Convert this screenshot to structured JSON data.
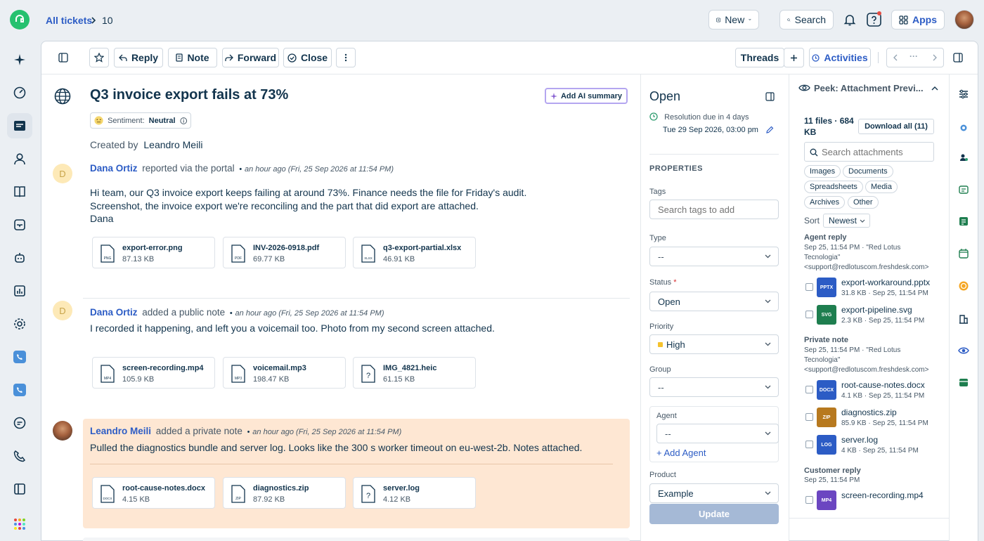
{
  "topbar": {
    "breadcrumb_root": "All tickets",
    "ticket_id": "10",
    "new_label": "New",
    "search_label": "Search",
    "apps_label": "Apps"
  },
  "toolbar": {
    "reply": "Reply",
    "note": "Note",
    "forward": "Forward",
    "close": "Close",
    "threads": "Threads",
    "activities": "Activities",
    "pager_dots": "···"
  },
  "ticket": {
    "title": "Q3 invoice export fails at 73%",
    "ai_summary": "Add AI summary",
    "sentiment_label": "Sentiment:",
    "sentiment_value": "Neutral",
    "created_by_label": "Created by",
    "created_by": "Leandro Meili"
  },
  "conversation": [
    {
      "avatar": "D",
      "author": "Dana Ortiz",
      "action": "reported via the portal",
      "bullet": "•",
      "time": "an hour ago (Fri, 25 Sep 2026 at 11:54 PM)",
      "lines": [
        "Hi team, our Q3 invoice export keeps failing at around 73%. Finance needs the file for Friday's audit.",
        "Screenshot, the invoice export we're reconciling and the part that did export are attached.",
        "Dana"
      ],
      "attachments": [
        {
          "name": "export-error.png",
          "size": "87.13 KB",
          "icon": "PNG"
        },
        {
          "name": "INV-2026-0918.pdf",
          "size": "69.77 KB",
          "icon": "PDF"
        },
        {
          "name": "q3-export-partial.xlsx",
          "size": "46.91 KB",
          "icon": "XLSX"
        }
      ]
    },
    {
      "avatar": "D",
      "author": "Dana Ortiz",
      "action": "added a public note",
      "bullet": "•",
      "time": "an hour ago (Fri, 25 Sep 2026 at 11:54 PM)",
      "lines": [
        "I recorded it happening, and left you a voicemail too. Photo from my second screen attached."
      ],
      "attachments": [
        {
          "name": "screen-recording.mp4",
          "size": "105.9 KB",
          "icon": "MP4"
        },
        {
          "name": "voicemail.mp3",
          "size": "198.47 KB",
          "icon": "MP3"
        },
        {
          "name": "IMG_4821.heic",
          "size": "61.15 KB",
          "icon": "?"
        }
      ]
    },
    {
      "author": "Leandro Meili",
      "action": "added a private note",
      "bullet": "•",
      "time": "an hour ago (Fri, 25 Sep 2026 at 11:54 PM)",
      "lines": [
        "Pulled the diagnostics bundle and server log. Looks like the 300 s worker timeout on eu-west-2b. Notes attached."
      ],
      "attachments": [
        {
          "name": "root-cause-notes.docx",
          "size": "4.15 KB",
          "icon": "DOCX"
        },
        {
          "name": "diagnostics.zip",
          "size": "87.92 KB",
          "icon": "ZIP"
        },
        {
          "name": "server.log",
          "size": "4.12 KB",
          "icon": "?"
        }
      ]
    }
  ],
  "properties": {
    "status_header": "Open",
    "resolution_label": "Resolution due in 4 days",
    "resolution_date": "Tue 29 Sep 2026, 03:00 pm",
    "section_title": "PROPERTIES",
    "tags_label": "Tags",
    "tags_placeholder": "Search tags to add",
    "type_label": "Type",
    "type_value": "--",
    "status_label": "Status",
    "required_mark": "*",
    "status_value": "Open",
    "priority_label": "Priority",
    "priority_value": "High",
    "group_label": "Group",
    "group_value": "--",
    "agent_label": "Agent",
    "agent_value": "--",
    "add_agent": "+ Add Agent",
    "product_label": "Product",
    "product_value": "Example",
    "update_button": "Update",
    "colors": {
      "priority_high": "#f5c22d",
      "accent": "#2c5cc5"
    }
  },
  "peek": {
    "title": "Peek: Attachment Previ...",
    "summary": "11 files · 684 KB",
    "download_all": "Download all (11)",
    "search_placeholder": "Search attachments",
    "filters": [
      "Images",
      "Documents",
      "Spreadsheets",
      "Media",
      "Archives",
      "Other"
    ],
    "sort_label": "Sort",
    "sort_value": "Newest",
    "groups": [
      {
        "title": "Agent reply",
        "meta": [
          "Sep 25, 11:54 PM · \"Red Lotus",
          "Tecnologia\"",
          "<support@redlotuscom.freshdesk.com>"
        ],
        "files": [
          {
            "badge": "PPTX",
            "name": "export-workaround.pptx",
            "meta": "31.8 KB · Sep 25, 11:54 PM",
            "color": "#2c5cc5"
          },
          {
            "badge": "SVG",
            "name": "export-pipeline.svg",
            "meta": "2.3 KB · Sep 25, 11:54 PM",
            "color": "#1e7e4f"
          }
        ]
      },
      {
        "title": "Private note",
        "meta": [
          "Sep 25, 11:54 PM · \"Red Lotus",
          "Tecnologia\"",
          "<support@redlotuscom.freshdesk.com>"
        ],
        "files": [
          {
            "badge": "DOCX",
            "name": "root-cause-notes.docx",
            "meta": "4.1 KB · Sep 25, 11:54 PM",
            "color": "#2c5cc5"
          },
          {
            "badge": "ZIP",
            "name": "diagnostics.zip",
            "meta": "85.9 KB · Sep 25, 11:54 PM",
            "color": "#b7791f"
          },
          {
            "badge": "LOG",
            "name": "server.log",
            "meta": "4 KB · Sep 25, 11:54 PM",
            "color": "#2c5cc5"
          }
        ]
      },
      {
        "title": "Customer reply",
        "meta": [
          "Sep 25, 11:54 PM"
        ],
        "files": [
          {
            "badge": "MP4",
            "name": "screen-recording.mp4",
            "meta": "",
            "color": "#6b46c1"
          }
        ]
      }
    ]
  }
}
